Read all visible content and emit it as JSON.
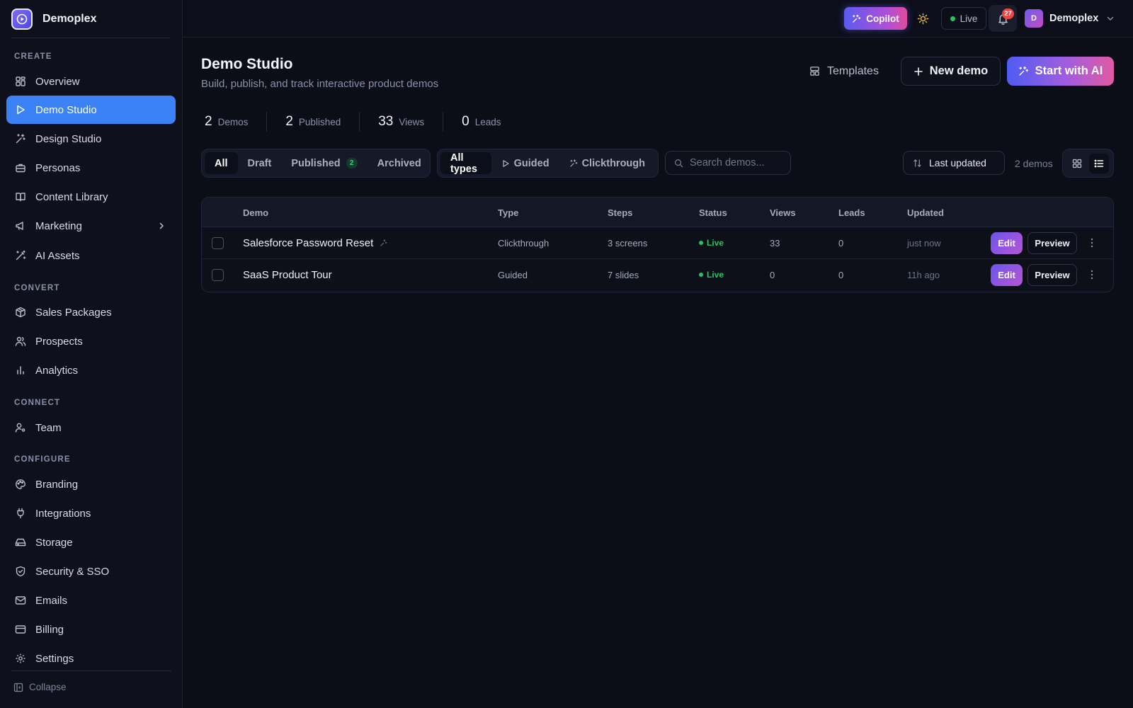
{
  "brand": {
    "name": "Demoplex"
  },
  "sidebar": {
    "sections": {
      "create": "CREATE",
      "convert": "CONVERT",
      "connect": "CONNECT",
      "configure": "CONFIGURE"
    },
    "items": {
      "overview": "Overview",
      "demo_studio": "Demo Studio",
      "design_studio": "Design Studio",
      "personas": "Personas",
      "content_library": "Content Library",
      "marketing": "Marketing",
      "ai_assets": "AI Assets",
      "sales_packages": "Sales Packages",
      "prospects": "Prospects",
      "analytics": "Analytics",
      "team": "Team",
      "branding": "Branding",
      "integrations": "Integrations",
      "storage": "Storage",
      "security": "Security & SSO",
      "emails": "Emails",
      "billing": "Billing",
      "settings": "Settings"
    },
    "active_item": "Demo Studio",
    "collapse_label": "Collapse"
  },
  "topbar": {
    "copilot_label": "Copilot",
    "live_label": "Live",
    "notification_count": "27",
    "user_initial": "D",
    "user_name": "Demoplex"
  },
  "page": {
    "title": "Demo Studio",
    "subtitle": "Build, publish, and track interactive product demos",
    "templates_label": "Templates",
    "new_demo_label": "New demo",
    "start_ai_label": "Start with AI"
  },
  "stats": [
    {
      "value": "2",
      "label": "Demos"
    },
    {
      "value": "2",
      "label": "Published"
    },
    {
      "value": "33",
      "label": "Views"
    },
    {
      "value": "0",
      "label": "Leads"
    }
  ],
  "filters": {
    "status_tabs": [
      "All",
      "Draft",
      "Published",
      "Archived"
    ],
    "published_count": "2",
    "active_status": "All",
    "type_tabs": [
      "All types",
      "Guided",
      "Clickthrough"
    ],
    "active_type": "All types",
    "search_placeholder": "Search demos...",
    "sort_label": "Last updated",
    "count_label": "2 demos",
    "active_view": "list"
  },
  "table": {
    "columns": [
      "Demo",
      "Type",
      "Steps",
      "Status",
      "Views",
      "Leads",
      "Updated"
    ],
    "rows": [
      {
        "name": "Salesforce Password Reset",
        "ai_generated": true,
        "type": "Clickthrough",
        "steps": "3 screens",
        "status": "Live",
        "views": "33",
        "leads": "0",
        "updated": "just now"
      },
      {
        "name": "SaaS Product Tour",
        "ai_generated": false,
        "type": "Guided",
        "steps": "7 slides",
        "status": "Live",
        "views": "0",
        "leads": "0",
        "updated": "11h ago"
      }
    ],
    "edit_label": "Edit",
    "preview_label": "Preview"
  },
  "colors": {
    "accent": "#3b82f6",
    "live": "#22c55e",
    "badge": "#ef4444",
    "background": "#0b0d17"
  }
}
